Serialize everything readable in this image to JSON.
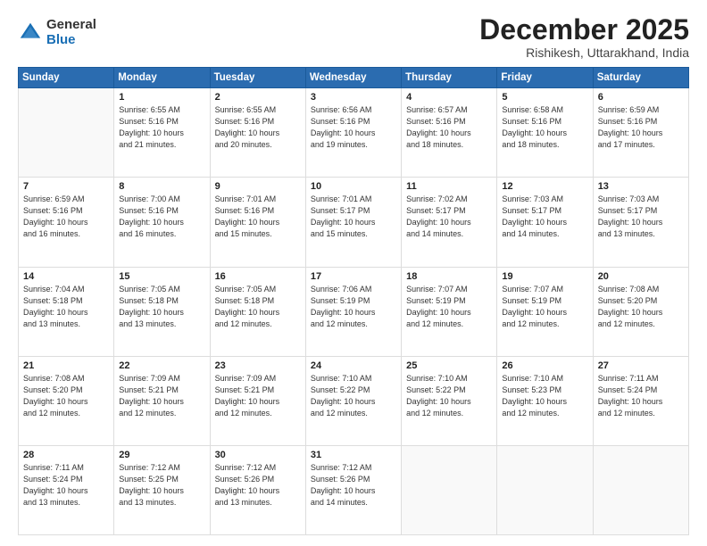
{
  "logo": {
    "general": "General",
    "blue": "Blue"
  },
  "title": "December 2025",
  "location": "Rishikesh, Uttarakhand, India",
  "headers": [
    "Sunday",
    "Monday",
    "Tuesday",
    "Wednesday",
    "Thursday",
    "Friday",
    "Saturday"
  ],
  "weeks": [
    [
      {
        "day": "",
        "info": ""
      },
      {
        "day": "1",
        "info": "Sunrise: 6:55 AM\nSunset: 5:16 PM\nDaylight: 10 hours\nand 21 minutes."
      },
      {
        "day": "2",
        "info": "Sunrise: 6:55 AM\nSunset: 5:16 PM\nDaylight: 10 hours\nand 20 minutes."
      },
      {
        "day": "3",
        "info": "Sunrise: 6:56 AM\nSunset: 5:16 PM\nDaylight: 10 hours\nand 19 minutes."
      },
      {
        "day": "4",
        "info": "Sunrise: 6:57 AM\nSunset: 5:16 PM\nDaylight: 10 hours\nand 18 minutes."
      },
      {
        "day": "5",
        "info": "Sunrise: 6:58 AM\nSunset: 5:16 PM\nDaylight: 10 hours\nand 18 minutes."
      },
      {
        "day": "6",
        "info": "Sunrise: 6:59 AM\nSunset: 5:16 PM\nDaylight: 10 hours\nand 17 minutes."
      }
    ],
    [
      {
        "day": "7",
        "info": "Sunrise: 6:59 AM\nSunset: 5:16 PM\nDaylight: 10 hours\nand 16 minutes."
      },
      {
        "day": "8",
        "info": "Sunrise: 7:00 AM\nSunset: 5:16 PM\nDaylight: 10 hours\nand 16 minutes."
      },
      {
        "day": "9",
        "info": "Sunrise: 7:01 AM\nSunset: 5:16 PM\nDaylight: 10 hours\nand 15 minutes."
      },
      {
        "day": "10",
        "info": "Sunrise: 7:01 AM\nSunset: 5:17 PM\nDaylight: 10 hours\nand 15 minutes."
      },
      {
        "day": "11",
        "info": "Sunrise: 7:02 AM\nSunset: 5:17 PM\nDaylight: 10 hours\nand 14 minutes."
      },
      {
        "day": "12",
        "info": "Sunrise: 7:03 AM\nSunset: 5:17 PM\nDaylight: 10 hours\nand 14 minutes."
      },
      {
        "day": "13",
        "info": "Sunrise: 7:03 AM\nSunset: 5:17 PM\nDaylight: 10 hours\nand 13 minutes."
      }
    ],
    [
      {
        "day": "14",
        "info": "Sunrise: 7:04 AM\nSunset: 5:18 PM\nDaylight: 10 hours\nand 13 minutes."
      },
      {
        "day": "15",
        "info": "Sunrise: 7:05 AM\nSunset: 5:18 PM\nDaylight: 10 hours\nand 13 minutes."
      },
      {
        "day": "16",
        "info": "Sunrise: 7:05 AM\nSunset: 5:18 PM\nDaylight: 10 hours\nand 12 minutes."
      },
      {
        "day": "17",
        "info": "Sunrise: 7:06 AM\nSunset: 5:19 PM\nDaylight: 10 hours\nand 12 minutes."
      },
      {
        "day": "18",
        "info": "Sunrise: 7:07 AM\nSunset: 5:19 PM\nDaylight: 10 hours\nand 12 minutes."
      },
      {
        "day": "19",
        "info": "Sunrise: 7:07 AM\nSunset: 5:19 PM\nDaylight: 10 hours\nand 12 minutes."
      },
      {
        "day": "20",
        "info": "Sunrise: 7:08 AM\nSunset: 5:20 PM\nDaylight: 10 hours\nand 12 minutes."
      }
    ],
    [
      {
        "day": "21",
        "info": "Sunrise: 7:08 AM\nSunset: 5:20 PM\nDaylight: 10 hours\nand 12 minutes."
      },
      {
        "day": "22",
        "info": "Sunrise: 7:09 AM\nSunset: 5:21 PM\nDaylight: 10 hours\nand 12 minutes."
      },
      {
        "day": "23",
        "info": "Sunrise: 7:09 AM\nSunset: 5:21 PM\nDaylight: 10 hours\nand 12 minutes."
      },
      {
        "day": "24",
        "info": "Sunrise: 7:10 AM\nSunset: 5:22 PM\nDaylight: 10 hours\nand 12 minutes."
      },
      {
        "day": "25",
        "info": "Sunrise: 7:10 AM\nSunset: 5:22 PM\nDaylight: 10 hours\nand 12 minutes."
      },
      {
        "day": "26",
        "info": "Sunrise: 7:10 AM\nSunset: 5:23 PM\nDaylight: 10 hours\nand 12 minutes."
      },
      {
        "day": "27",
        "info": "Sunrise: 7:11 AM\nSunset: 5:24 PM\nDaylight: 10 hours\nand 12 minutes."
      }
    ],
    [
      {
        "day": "28",
        "info": "Sunrise: 7:11 AM\nSunset: 5:24 PM\nDaylight: 10 hours\nand 13 minutes."
      },
      {
        "day": "29",
        "info": "Sunrise: 7:12 AM\nSunset: 5:25 PM\nDaylight: 10 hours\nand 13 minutes."
      },
      {
        "day": "30",
        "info": "Sunrise: 7:12 AM\nSunset: 5:26 PM\nDaylight: 10 hours\nand 13 minutes."
      },
      {
        "day": "31",
        "info": "Sunrise: 7:12 AM\nSunset: 5:26 PM\nDaylight: 10 hours\nand 14 minutes."
      },
      {
        "day": "",
        "info": ""
      },
      {
        "day": "",
        "info": ""
      },
      {
        "day": "",
        "info": ""
      }
    ]
  ]
}
